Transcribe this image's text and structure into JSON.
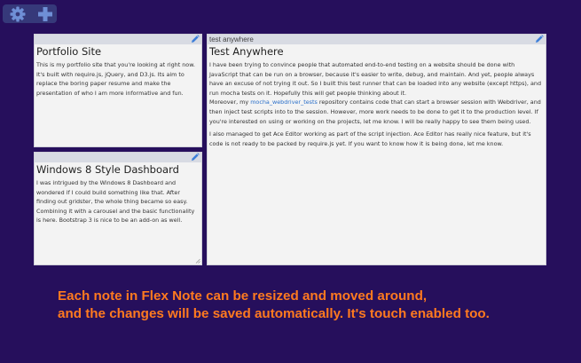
{
  "colors": {
    "background": "#260f5c",
    "toolbar": "#36397a",
    "caption": "#ff7a1f",
    "link": "#2a6fc9"
  },
  "toolbar": {
    "settings_icon": "gear-icon",
    "add_icon": "plus-icon"
  },
  "notes": [
    {
      "header": "",
      "title": "Portfolio Site",
      "body": "This is my portfolio site that you're looking at right now. It's built with require.js, jQuery, and D3.js. Its aim to replace the boring paper resume and make the presentation of who I am more informative and fun."
    },
    {
      "header": "",
      "title": "Windows 8 Style Dashboard",
      "body": "I was intrigued by the Windows 8 Dashboard and wondered if I could build something like that. After finding out gridster, the whole thing became so easy. Combining it with a carousel and the basic functionality is here. Bootstrap 3 is nice to be an add-on as well."
    },
    {
      "header": "test anywhere",
      "title": "Test Anywhere",
      "p1": "I have been trying to convince people that automated end-to-end testing on a website should be done with JavaScript that can be run on a browser, because it's easier to write, debug, and maintain. And yet, people always have an excuse of not trying it out. So I built this test runner that can be loaded into any website (except https), and run mocha tests on it. Hopefully this will get people thinking about it.",
      "p2_before": "Moreover, my ",
      "p2_link": "mocha_webdriver_tests",
      "p2_after": " repository contains code that can start a browser session with Webdriver, and then inject test scripts into to the session. However, more work needs to be done to get it to the production level. If you're interested on using or working on the projects, let me know. I will be really happy to see them being used.",
      "p3": "I also managed to get Ace Editor working as part of the script injection. Ace Editor has really nice feature, but it's code is not ready to be packed by require.js yet. If you want to know how it is being done, let me know."
    }
  ],
  "caption": {
    "line1": "Each note in Flex Note can be resized and moved around,",
    "line2": "and the changes will be saved automatically. It's touch enabled too."
  }
}
